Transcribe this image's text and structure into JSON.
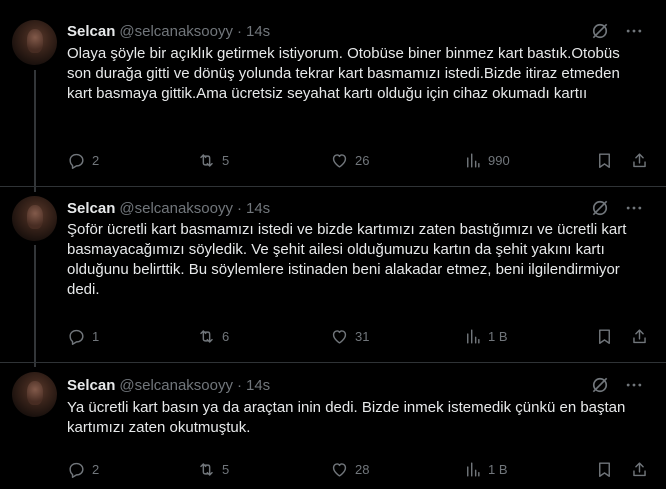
{
  "colors": {
    "background": "#000000",
    "text": "#e7e9ea",
    "muted": "#71767b",
    "divider": "#2f3336"
  },
  "tweets": [
    {
      "name": "Selcan",
      "handle": "@selcanaksooyy",
      "dot": "·",
      "time": "14s",
      "text": "Olaya şöyle bir açıklık getirmek istiyorum. Otobüse biner binmez kart bastık.Otobüs son durağa gitti ve dönüş yolunda tekrar kart basmamızı istedi.Bizde itiraz etmeden kart basmaya gittik.Ama ücretsiz seyahat kartı olduğu için cihaz okumadı kartıı",
      "replies": "2",
      "reposts": "5",
      "likes": "26",
      "views": "990"
    },
    {
      "name": "Selcan",
      "handle": "@selcanaksooyy",
      "dot": "·",
      "time": "14s",
      "text": "Şoför ücretli kart basmamızı istedi ve bizde kartımızı zaten bastığımızı ve ücretli kart basmayacağımızı söyledik. Ve şehit ailesi olduğumuzu kartın da şehit yakını kartı olduğunu belirttik. Bu söylemlere istinaden beni alakadar etmez, beni ilgilendirmiyor dedi.",
      "replies": "1",
      "reposts": "6",
      "likes": "31",
      "views": "1 B"
    },
    {
      "name": "Selcan",
      "handle": "@selcanaksooyy",
      "dot": "·",
      "time": "14s",
      "text": "Ya ücretli kart basın ya da araçtan inin dedi. Bizde inmek istemedik çünkü en baştan kartımızı zaten okutmuştuk.",
      "replies": "2",
      "reposts": "5",
      "likes": "28",
      "views": "1 B"
    }
  ]
}
